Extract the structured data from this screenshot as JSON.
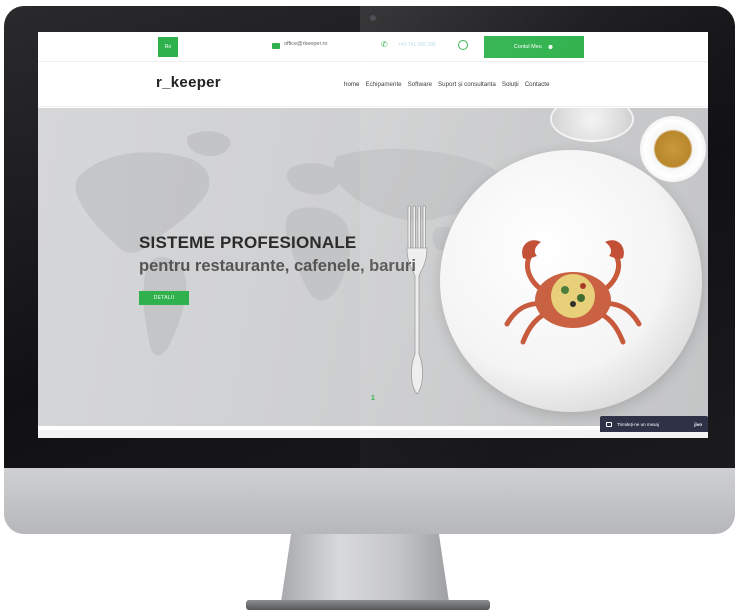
{
  "topbar": {
    "language": "Ro",
    "email": "office@rkeeper.ro",
    "phone": "+40 741 095 298",
    "account_button": "Contul Meu"
  },
  "nav": {
    "logo": "r_keeper",
    "items": [
      "home",
      "Echipamente",
      "Software",
      "Suport și consultanta",
      "Soluții",
      "Contacte"
    ]
  },
  "hero": {
    "title": "SISTEME PROFESIONALE",
    "subtitle": "pentru restaurante, cafenele, baruri",
    "button": "DETALII",
    "slide_number": "1"
  },
  "chat": {
    "label": "Trimiteți-ne un mesaj",
    "brand": "jivo"
  },
  "colors": {
    "accent": "#2fb24d",
    "chat_bg": "#2f3147",
    "hero_bg": "#d0d1d2"
  },
  "icons": [
    "mail-icon",
    "phone-icon",
    "whatsapp-icon",
    "user-icon",
    "envelope-icon"
  ]
}
